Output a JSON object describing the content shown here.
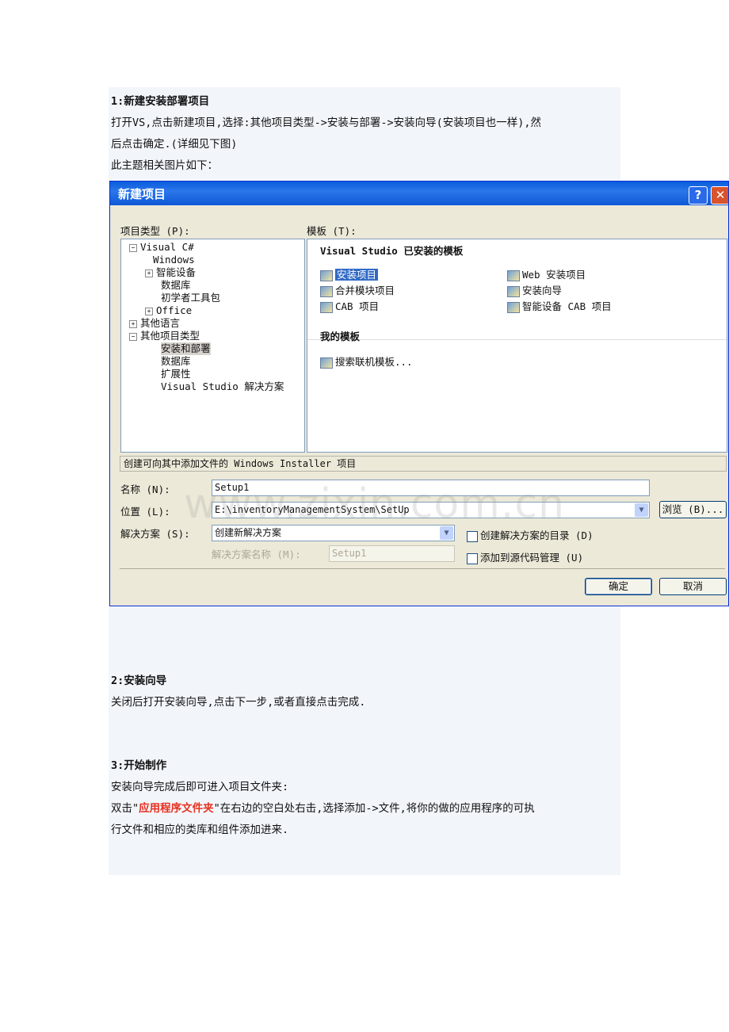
{
  "doc": {
    "s1_heading": "1:新建安装部署项目",
    "s1_line1": "打开VS,点击新建项目,选择:其他项目类型->安装与部署->安装向导(安装项目也一样),然",
    "s1_line2": "后点击确定.(详细见下图)",
    "s1_line3": "此主题相关图片如下：",
    "s2_heading": "2:安装向导",
    "s2_line1": "关闭后打开安装向导,点击下一步,或者直接点击完成.",
    "s3_heading": "3:开始制作",
    "s3_line1": "安装向导完成后即可进入项目文件夹:",
    "s3_line2_pre": "双击\"",
    "s3_line2_red": "应用程序文件夹",
    "s3_line2_post": "\"在右边的空白处右击,选择添加->文件,将你的做的应用程序的可执",
    "s3_line3": "行文件和相应的类库和组件添加进来."
  },
  "dialog": {
    "title": "新建项目",
    "help_btn": "?",
    "close_btn": "✕",
    "project_types_label": "项目类型 (P):",
    "templates_label": "模板 (T):",
    "tree": [
      "Visual C#",
      "Windows",
      "智能设备",
      "数据库",
      "初学者工具包",
      "Office",
      "其他语言",
      "其他项目类型",
      "安装和部署",
      "数据库",
      "扩展性",
      "Visual Studio 解决方案"
    ],
    "installed_header": "Visual Studio 已安装的模板",
    "templates_left": [
      "安装项目",
      "合并模块项目",
      "CAB 项目"
    ],
    "templates_right": [
      "Web 安装项目",
      "安装向导",
      "智能设备 CAB 项目"
    ],
    "my_templates_header": "我的模板",
    "search_template": "搜索联机模板...",
    "description": "创建可向其中添加文件的 Windows Installer 项目",
    "name_label": "名称 (N):",
    "name_value": "Setup1",
    "location_label": "位置 (L):",
    "location_value": "E:\\inventoryManagementSystem\\SetUp",
    "browse_btn": "浏览 (B)...",
    "solution_label": "解决方案 (S):",
    "solution_value": "创建新解决方案",
    "solution_name_label": "解决方案名称 (M):",
    "solution_name_value": "Setup1",
    "chk_create_dir": "创建解决方案的目录 (D)",
    "chk_source_control": "添加到源代码管理 (U)",
    "ok_btn": "确定",
    "cancel_btn": "取消"
  },
  "watermark": "www.zixin.com.cn"
}
